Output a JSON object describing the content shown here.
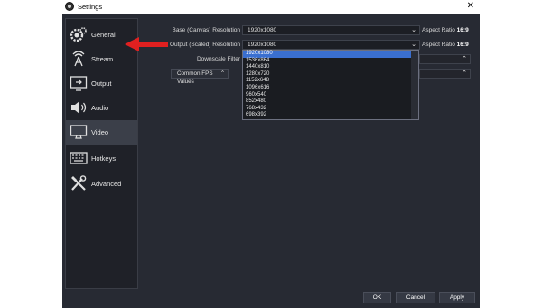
{
  "window": {
    "title": "Settings",
    "close_glyph": "✕"
  },
  "sidebar": {
    "items": [
      {
        "label": "General",
        "icon": "gear-icon"
      },
      {
        "label": "Stream",
        "icon": "antenna-icon"
      },
      {
        "label": "Output",
        "icon": "output-icon"
      },
      {
        "label": "Audio",
        "icon": "speaker-icon"
      },
      {
        "label": "Video",
        "icon": "monitor-icon",
        "selected": true
      },
      {
        "label": "Hotkeys",
        "icon": "keyboard-icon"
      },
      {
        "label": "Advanced",
        "icon": "tools-icon"
      }
    ]
  },
  "video": {
    "base_label": "Base (Canvas) Resolution",
    "base_value": "1920x1080",
    "base_aspect_prefix": "Aspect Ratio",
    "base_aspect_value": "16:9",
    "output_label": "Output (Scaled) Resolution",
    "output_value": "1920x1080",
    "output_aspect_prefix": "Aspect Ratio",
    "output_aspect_value": "16:9",
    "downscale_label": "Downscale Filter",
    "fps_label": "Common FPS Values",
    "dropdown_options": [
      "1920x1080",
      "1536x864",
      "1440x810",
      "1280x720",
      "1152x648",
      "1096x616",
      "960x540",
      "852x480",
      "768x432",
      "698x392"
    ],
    "dropdown_selected_index": 0
  },
  "buttons": {
    "ok": "OK",
    "cancel": "Cancel",
    "apply": "Apply"
  },
  "colors": {
    "accent_arrow": "#e02020",
    "selection": "#3a6fd0",
    "window_bg": "#272a33"
  }
}
